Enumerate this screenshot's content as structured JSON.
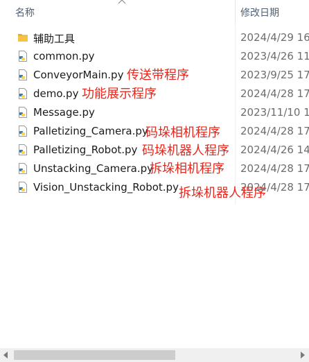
{
  "header": {
    "name_label": "名称",
    "date_label": "修改日期"
  },
  "files": [
    {
      "name": "辅助工具",
      "date": "2024/4/29 16:",
      "icon": "folder-icon"
    },
    {
      "name": "common.py",
      "date": "2023/4/26 11:",
      "icon": "python-file-icon"
    },
    {
      "name": "ConveyorMain.py",
      "date": "2023/9/25 17:",
      "icon": "python-file-icon"
    },
    {
      "name": "demo.py",
      "date": "2024/4/28 17:",
      "icon": "python-file-icon"
    },
    {
      "name": "Message.py",
      "date": "2023/11/10 1",
      "icon": "python-file-icon"
    },
    {
      "name": "Palletizing_Camera.py",
      "date": "2024/4/28 17:",
      "icon": "python-file-icon"
    },
    {
      "name": "Palletizing_Robot.py",
      "date": "2024/4/26 14:",
      "icon": "python-file-icon"
    },
    {
      "name": "Unstacking_Camera.py",
      "date": "2024/4/28 17:",
      "icon": "python-file-icon"
    },
    {
      "name": "Vision_Unstacking_Robot.py",
      "date": "2024/4/28 17:",
      "icon": "python-file-icon"
    }
  ],
  "annotations": {
    "conveyor": "传送带程序",
    "demo": "功能展示程序",
    "palletizing_camera": "码垛相机程序",
    "palletizing_robot": "码垛机器人程序",
    "unstacking_camera": "拆垛相机程序",
    "vision_unstacking_robot": "拆垛机器人程序"
  },
  "colors": {
    "annotation": "#e8261b",
    "header_text": "#4c607a",
    "folder": "#f6c342",
    "python_blue": "#3c78aa",
    "python_yellow": "#ffd43b"
  }
}
